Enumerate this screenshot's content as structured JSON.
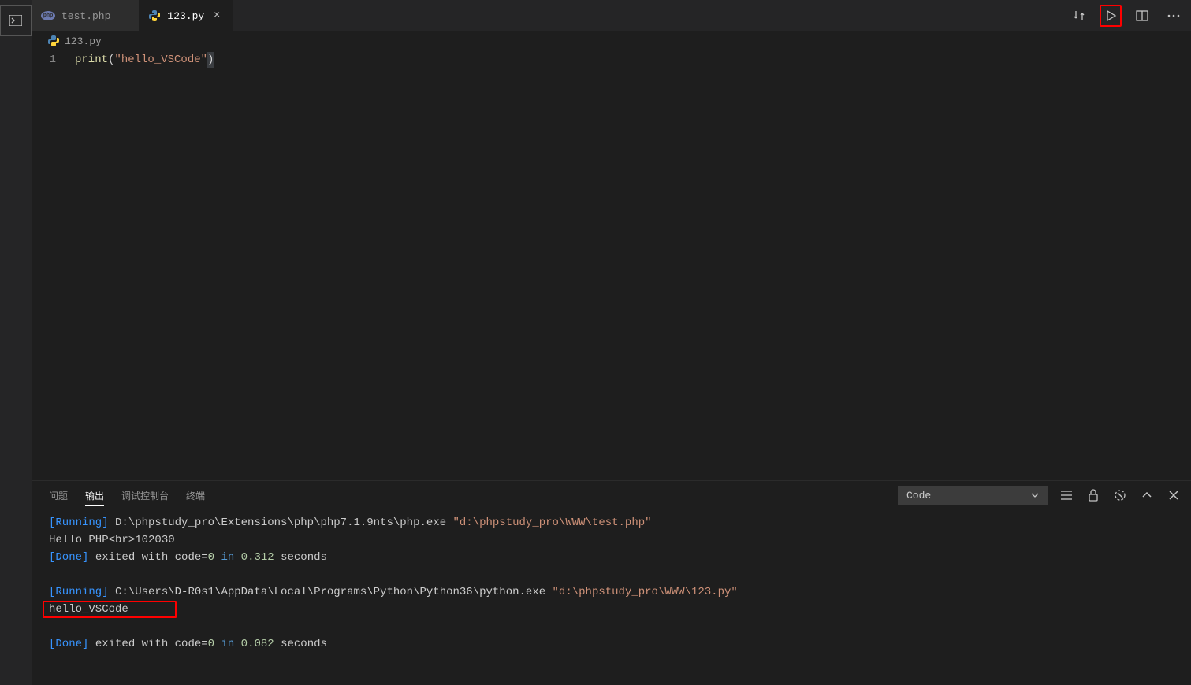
{
  "activity_icon": "terminal-icon",
  "tabs": [
    {
      "label": "test.php",
      "icon": "php",
      "active": false
    },
    {
      "label": "123.py",
      "icon": "python",
      "active": true
    }
  ],
  "breadcrumb": {
    "file": "123.py",
    "icon": "python"
  },
  "editor": {
    "line_number": "1",
    "tokens": {
      "func": "print",
      "lparen": "(",
      "string": "\"hello_VSCode\"",
      "rparen": ")"
    }
  },
  "panel_tabs": {
    "problems": "问题",
    "output": "输出",
    "debug_console": "调试控制台",
    "terminal": "终端"
  },
  "panel_select": "Code",
  "output": {
    "run1_tag": "[Running]",
    "run1_cmd": " D:\\phpstudy_pro\\Extensions\\php\\php7.1.9nts\\php.exe ",
    "run1_arg": "\"d:\\phpstudy_pro\\WWW\\test.php\"",
    "run1_out": "Hello PHP<br>102030",
    "done1_tag": "[Done]",
    "done1_text1": " exited with code=",
    "done1_code": "0",
    "done1_text2": " in ",
    "done1_time": "0.312",
    "done1_text3": " seconds",
    "run2_tag": "[Running]",
    "run2_cmd": " C:\\Users\\D-R0s1\\AppData\\Local\\Programs\\Python\\Python36\\python.exe ",
    "run2_arg": "\"d:\\phpstudy_pro\\WWW\\123.py\"",
    "run2_out": "hello_VSCode",
    "done2_tag": "[Done]",
    "done2_text1": " exited with code=",
    "done2_code": "0",
    "done2_text2": " in ",
    "done2_time": "0.082",
    "done2_text3": " seconds"
  }
}
